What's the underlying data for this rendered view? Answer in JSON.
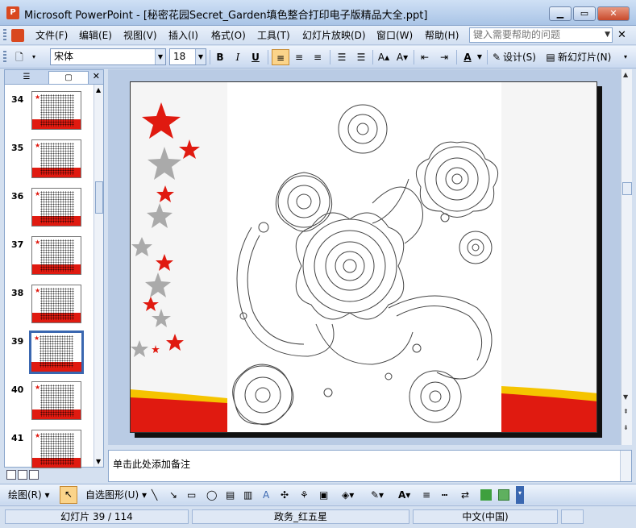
{
  "window": {
    "title": "Microsoft PowerPoint - [秘密花园Secret_Garden填色整合打印电子版精品大全.ppt]",
    "app_icon_text": "P"
  },
  "menu": {
    "items": [
      "文件(F)",
      "编辑(E)",
      "视图(V)",
      "插入(I)",
      "格式(O)",
      "工具(T)",
      "幻灯片放映(D)",
      "窗口(W)",
      "帮助(H)"
    ],
    "help_placeholder": "键入需要帮助的问题"
  },
  "toolbar": {
    "font_name": "宋体",
    "font_size": "18",
    "bold": "B",
    "italic": "I",
    "underline": "U",
    "design_label": "设计(S)",
    "new_slide_label": "新幻灯片(N)"
  },
  "slides_panel": {
    "slides": [
      {
        "num": "34"
      },
      {
        "num": "35"
      },
      {
        "num": "36"
      },
      {
        "num": "37"
      },
      {
        "num": "38"
      },
      {
        "num": "39",
        "selected": true
      },
      {
        "num": "40"
      },
      {
        "num": "41"
      }
    ]
  },
  "notes": {
    "placeholder": "单击此处添加备注"
  },
  "drawing_toolbar": {
    "draw_label": "绘图(R)",
    "autoshapes_label": "自选图形(U)"
  },
  "status": {
    "slide_info": "幻灯片 39 / 114",
    "design_name": "政务_红五星",
    "language": "中文(中国)"
  },
  "colors": {
    "accent_red": "#e01a10",
    "accent_yellow": "#f5c400",
    "star_gray": "#aaaaaa"
  }
}
